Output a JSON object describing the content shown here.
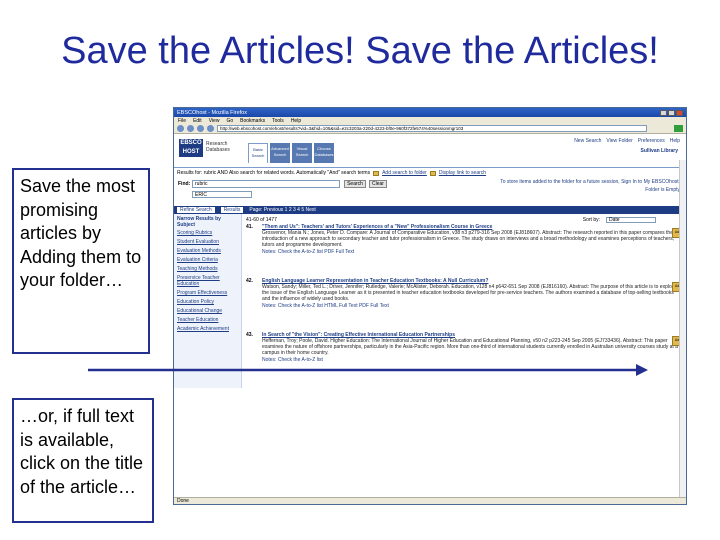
{
  "slide": {
    "title": "Save the Articles! Save the Articles!",
    "callout_top": "Save the most promising articles by Adding them to your folder…",
    "callout_bottom": "…or, if full text is available, click on the title of the article…",
    "colors": {
      "title": "#1f2b9c",
      "callout_border": "#23308f",
      "arrow": "#23308f"
    }
  },
  "browser": {
    "window_title": "EBSCOhost - Mozilla Firefox",
    "menu": [
      "File",
      "Edit",
      "View",
      "Go",
      "Bookmarks",
      "Tools",
      "Help"
    ],
    "url": "http://web.ebscohost.com/ehost/results?vid=3&hid=105&sid=e2c3203a-220d-4223-bf0e-960f372fe574%40sessionmgr103"
  },
  "ebsco": {
    "logo": "EBSCO HOST",
    "logo_sub": "Research Databases",
    "tabs": [
      "Basic Search",
      "Advanced Search",
      "Visual Search",
      "Choose Databases"
    ],
    "top_links": [
      "New Search",
      "View Folder",
      "Preferences",
      "Help"
    ],
    "library": "Sullivan Library",
    "results_for": "Results for: rubric AND Also search for related words. Automatically \"And\" search terms",
    "add_search_to_folder": "Add search to folder",
    "display_link": "Display link to search",
    "find_label": "Find:",
    "find_value": "rubric",
    "in_value": "ERIC",
    "search_button": "Search",
    "clear_button": "Clear",
    "folder_help": "To store items added to the folder for a future session, Sign In to My EBSCOhost.",
    "signin_link": "Folder is Empty",
    "refine_tabs": [
      "Refine Search",
      "Results"
    ],
    "pager": "Page: Previous 1 2 3 4 5 Next",
    "count_text": "41-60 of 1477",
    "sort_label": "Sort by:",
    "sort_value": "Date",
    "leftnav": {
      "header": "Narrow Results by Subject",
      "items": [
        "Scoring Rubrics",
        "Student Evaluation",
        "Evaluation Methods",
        "Evaluation Criteria",
        "Teaching Methods",
        "Preservice Teacher Education",
        "Program Effectiveness",
        "Education Policy",
        "Educational Change",
        "Teacher Education",
        "Academic Achievement"
      ]
    },
    "records": [
      {
        "num": "41.",
        "title": "\"Them and Us\": Teachers' and Tutors' Experiences of a \"New\" Professionalism Course in Greece",
        "text": "Grosvenor, Mania N.; Jones, Peter D. Compare: A Journal of Comparative Education, v38 n3 p279-316 Sep 2008 (EJ818607). Abstract: The research reported in this paper compares the introduction of a new approach to secondary teacher and tutor professionalism in Greece. The study draws on interviews and a broad methodology and examines perceptions of teachers, tutors and programme development.",
        "links": "Notes: Check the A-to-Z list   PDF Full Text",
        "add": "Add"
      },
      {
        "num": "42.",
        "title": "English Language Learner Representation in Teacher Education Textbooks: A Null Curriculum?",
        "text": "Watson, Sandy; Miller, Ted L.; Driver, Jennifer; Rutledge, Valerie; McAlister, Deborah. Education, v128 n4 p642-651 Sep 2008 (EJ816160). Abstract: The purpose of this article is to explore the issue of the English Language Learner as it is presented in teacher education textbooks developed for pre-service teachers. The authors examined a database of top-selling textbooks and the influence of widely used books.",
        "links": "Notes: Check the A-to-Z list   HTML Full Text   PDF Full Text",
        "add": "Add"
      },
      {
        "num": "43.",
        "title": "In Search of \"the Vision\": Creating Effective International Education Partnerships",
        "text": "Heffernan, Troy; Poole, David. Higher Education: The International Journal of Higher Education and Educational Planning, v50 n2 p223-245 Sep 2005 (EJ733436). Abstract: This paper examines the nature of offshore partnerships, particularly in the Asia-Pacific region. More than one-third of international students currently enrolled in Australian university courses study at a campus in their home country.",
        "links": "Notes: Check the A-to-Z list",
        "add": "Add"
      }
    ],
    "status": "Done"
  }
}
